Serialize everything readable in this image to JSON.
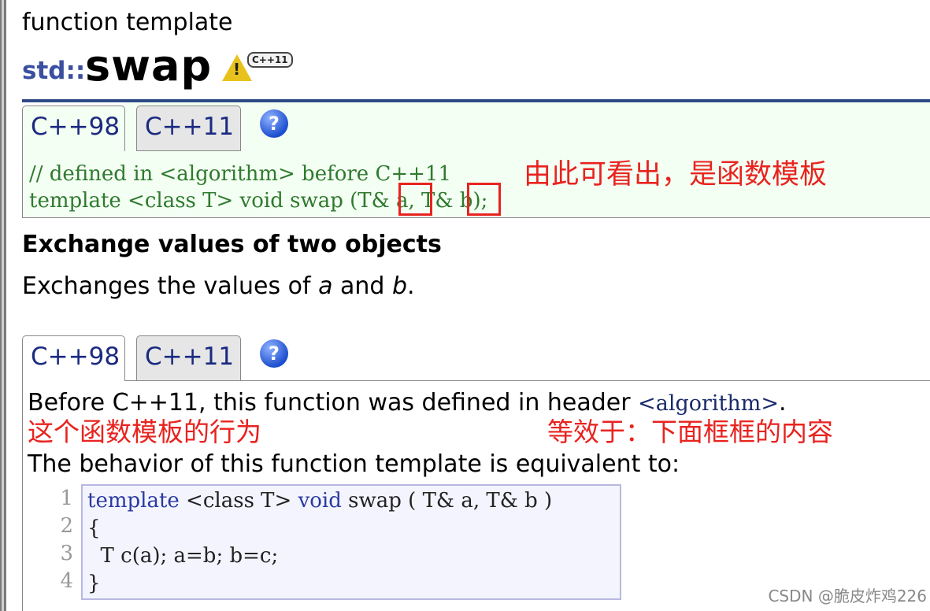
{
  "header": {
    "kicker": "function template",
    "namespace": "std::",
    "function_name": "swap",
    "badge_label": "C++11"
  },
  "tabs_top": {
    "tab_98": "C++98",
    "tab_11": "C++11",
    "help": "?"
  },
  "declaration": {
    "line1": "// defined in <algorithm> before C++11",
    "line2": "template <class T> void swap (T& a, T& b);",
    "annotation": "由此可看出，是函数模板"
  },
  "section": {
    "heading": "Exchange values of two objects",
    "description_prefix": "Exchanges the values of ",
    "description_a": "a",
    "description_mid": " and ",
    "description_b": "b",
    "description_suffix": "."
  },
  "tabs_bottom": {
    "tab_98": "C++98",
    "tab_11": "C++11",
    "help": "?"
  },
  "body": {
    "line1_prefix": "Before C++11, this function was defined in header ",
    "line1_header": "<algorithm>",
    "line1_suffix": ".",
    "annotation_left": "这个函数模板的行为",
    "annotation_right": "等效于：下面框框的内容",
    "line3": "The behavior of this function template is equivalent to:"
  },
  "code": {
    "line_numbers": [
      "1",
      "2",
      "3",
      "4"
    ],
    "line1_kw1": "template",
    "line1_mid": " <class T> ",
    "line1_kw2": "void",
    "line1_rest": " swap ( T& a, T& b )",
    "line2": "{",
    "line3": "  T c(a); a=b; b=c;",
    "line4": "}"
  },
  "watermark": "CSDN @脆皮炸鸡226",
  "colors": {
    "accent_blue": "#2e4a86",
    "annotation_red": "#e8231f",
    "code_green": "#2f7a2f"
  }
}
